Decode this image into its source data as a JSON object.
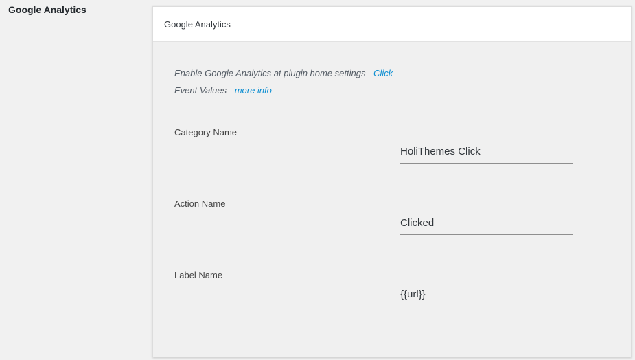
{
  "section": {
    "title": "Google Analytics"
  },
  "card": {
    "header": "Google Analytics",
    "info_line1_text": "Enable Google Analytics at plugin home settings - ",
    "info_line1_link": "Click",
    "info_line2_text": "Event Values - ",
    "info_line2_link": "more info"
  },
  "fields": [
    {
      "label": "Category Name",
      "value": "HoliThemes Click"
    },
    {
      "label": "Action Name",
      "value": "Clicked"
    },
    {
      "label": "Label Name",
      "value": "{{url}}"
    }
  ]
}
